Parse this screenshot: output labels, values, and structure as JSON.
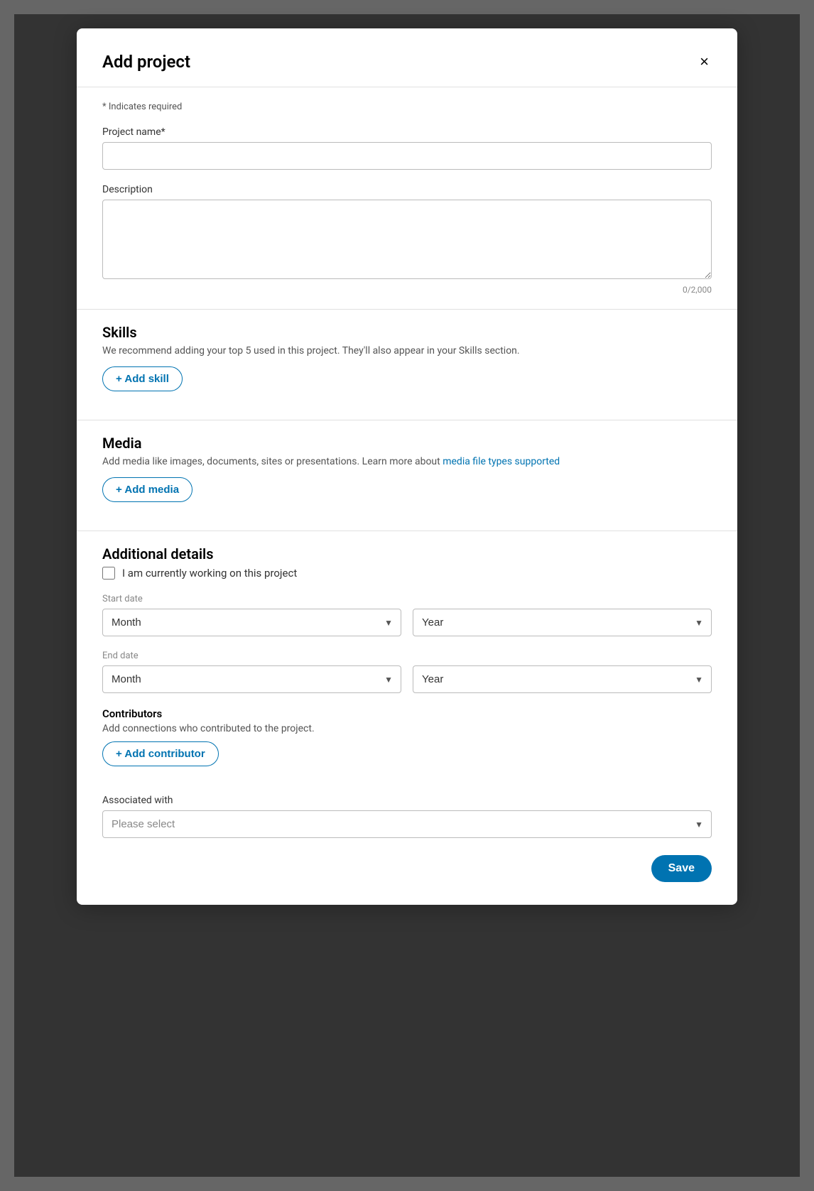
{
  "modal": {
    "title": "Add project",
    "close_label": "×",
    "required_note": "* Indicates required"
  },
  "form": {
    "project_name_label": "Project name*",
    "project_name_placeholder": "",
    "description_label": "Description",
    "description_placeholder": "",
    "char_count": "0/2,000",
    "skills_section": {
      "title": "Skills",
      "description": "We recommend adding your top 5 used in this project. They'll also appear in your Skills section.",
      "add_skill_label": "+ Add skill"
    },
    "media_section": {
      "title": "Media",
      "description_start": "Add media like images, documents, sites or presentations. Learn more about ",
      "description_link": "media file types supported",
      "add_media_label": "+ Add media"
    },
    "additional_details": {
      "title": "Additional details",
      "currently_working_label": "I am currently working on this project",
      "start_date_label": "Start date",
      "start_month_placeholder": "Month",
      "start_year_placeholder": "Year",
      "end_date_label": "End date",
      "end_month_placeholder": "Month",
      "end_year_placeholder": "Year"
    },
    "contributors_section": {
      "title": "Contributors",
      "description": "Add connections who contributed to the project.",
      "add_contributor_label": "+ Add contributor"
    },
    "associated_with": {
      "label": "Associated with",
      "placeholder": "Please select",
      "options": [
        "Please select"
      ]
    },
    "save_button": "Save"
  }
}
